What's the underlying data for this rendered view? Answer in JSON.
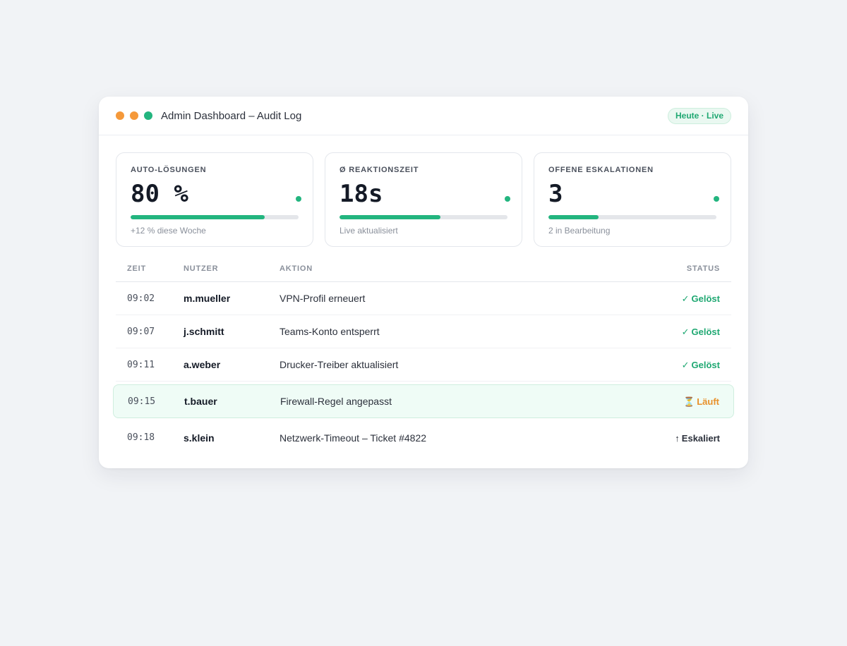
{
  "window": {
    "title": "Admin Dashboard – Audit Log",
    "badge": "Heute · Live"
  },
  "cards": [
    {
      "label": "AUTO-LÖSUNGEN",
      "value": "80 %",
      "progress_percent": 80,
      "sub": "+12 % diese Woche"
    },
    {
      "label": "Ø REAKTIONSZEIT",
      "value": "18s",
      "progress_percent": 60,
      "sub": "Live aktualisiert"
    },
    {
      "label": "OFFENE ESKALATIONEN",
      "value": "3",
      "progress_percent": 30,
      "sub": "2 in Bearbeitung"
    }
  ],
  "table": {
    "headers": {
      "time": "ZEIT",
      "user": "NUTZER",
      "action": "AKTION",
      "status": "STATUS"
    },
    "rows": [
      {
        "time": "09:02",
        "user": "m.mueller",
        "action": "VPN-Profil erneuert",
        "status": "Gelöst",
        "status_icon": "✓",
        "status_type": "resolved"
      },
      {
        "time": "09:07",
        "user": "j.schmitt",
        "action": "Teams-Konto entsperrt",
        "status": "Gelöst",
        "status_icon": "✓",
        "status_type": "resolved"
      },
      {
        "time": "09:11",
        "user": "a.weber",
        "action": "Drucker-Treiber aktualisiert",
        "status": "Gelöst",
        "status_icon": "✓",
        "status_type": "resolved"
      },
      {
        "time": "09:15",
        "user": "t.bauer",
        "action": "Firewall-Regel angepasst",
        "status": "Läuft",
        "status_icon": "⏳",
        "status_type": "running"
      },
      {
        "time": "09:18",
        "user": "s.klein",
        "action": "Netzwerk-Timeout – Ticket #4822",
        "status": "Eskaliert",
        "status_icon": "↑",
        "status_type": "escalated"
      }
    ]
  },
  "colors": {
    "accent_green": "#23b57f",
    "dot_orange": "#f5993a",
    "status_running": "#e8912b",
    "active_row_bg": "#effcf6"
  }
}
